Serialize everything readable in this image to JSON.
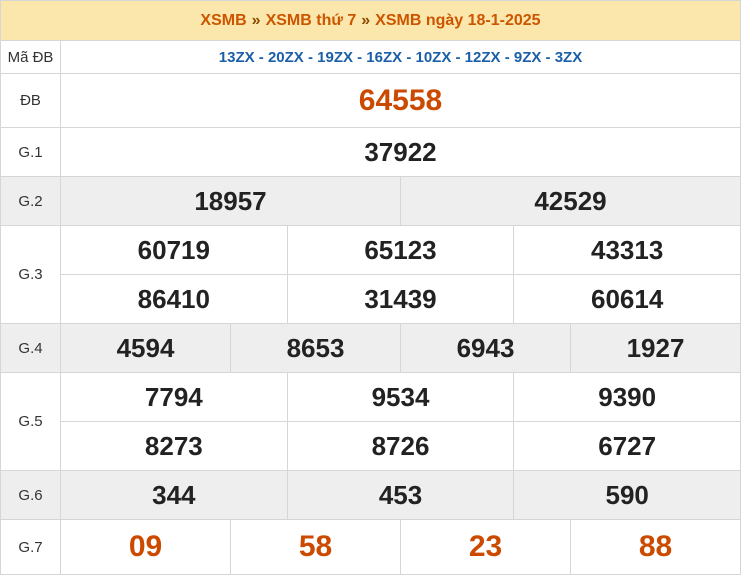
{
  "header": {
    "crumb1": "XSMB",
    "sep": "»",
    "crumb2": "XSMB thứ 7",
    "crumb3": "XSMB ngày 18-1-2025"
  },
  "rows": {
    "madb": {
      "label": "Mã ĐB",
      "value": "13ZX - 20ZX - 19ZX - 16ZX - 10ZX - 12ZX - 9ZX - 3ZX"
    },
    "db": {
      "label": "ĐB",
      "values": [
        "64558"
      ]
    },
    "g1": {
      "label": "G.1",
      "values": [
        "37922"
      ]
    },
    "g2": {
      "label": "G.2",
      "values": [
        "18957",
        "42529"
      ]
    },
    "g3": {
      "label": "G.3",
      "values": [
        "60719",
        "65123",
        "43313",
        "86410",
        "31439",
        "60614"
      ]
    },
    "g4": {
      "label": "G.4",
      "values": [
        "4594",
        "8653",
        "6943",
        "1927"
      ]
    },
    "g5": {
      "label": "G.5",
      "values": [
        "7794",
        "9534",
        "9390",
        "8273",
        "8726",
        "6727"
      ]
    },
    "g6": {
      "label": "G.6",
      "values": [
        "344",
        "453",
        "590"
      ]
    },
    "g7": {
      "label": "G.7",
      "values": [
        "09",
        "58",
        "23",
        "88"
      ]
    }
  },
  "colors": {
    "header_bg": "#fbe6ab",
    "accent": "#cc4a00",
    "code": "#1a5fa8",
    "stripe": "#eeeeee"
  }
}
